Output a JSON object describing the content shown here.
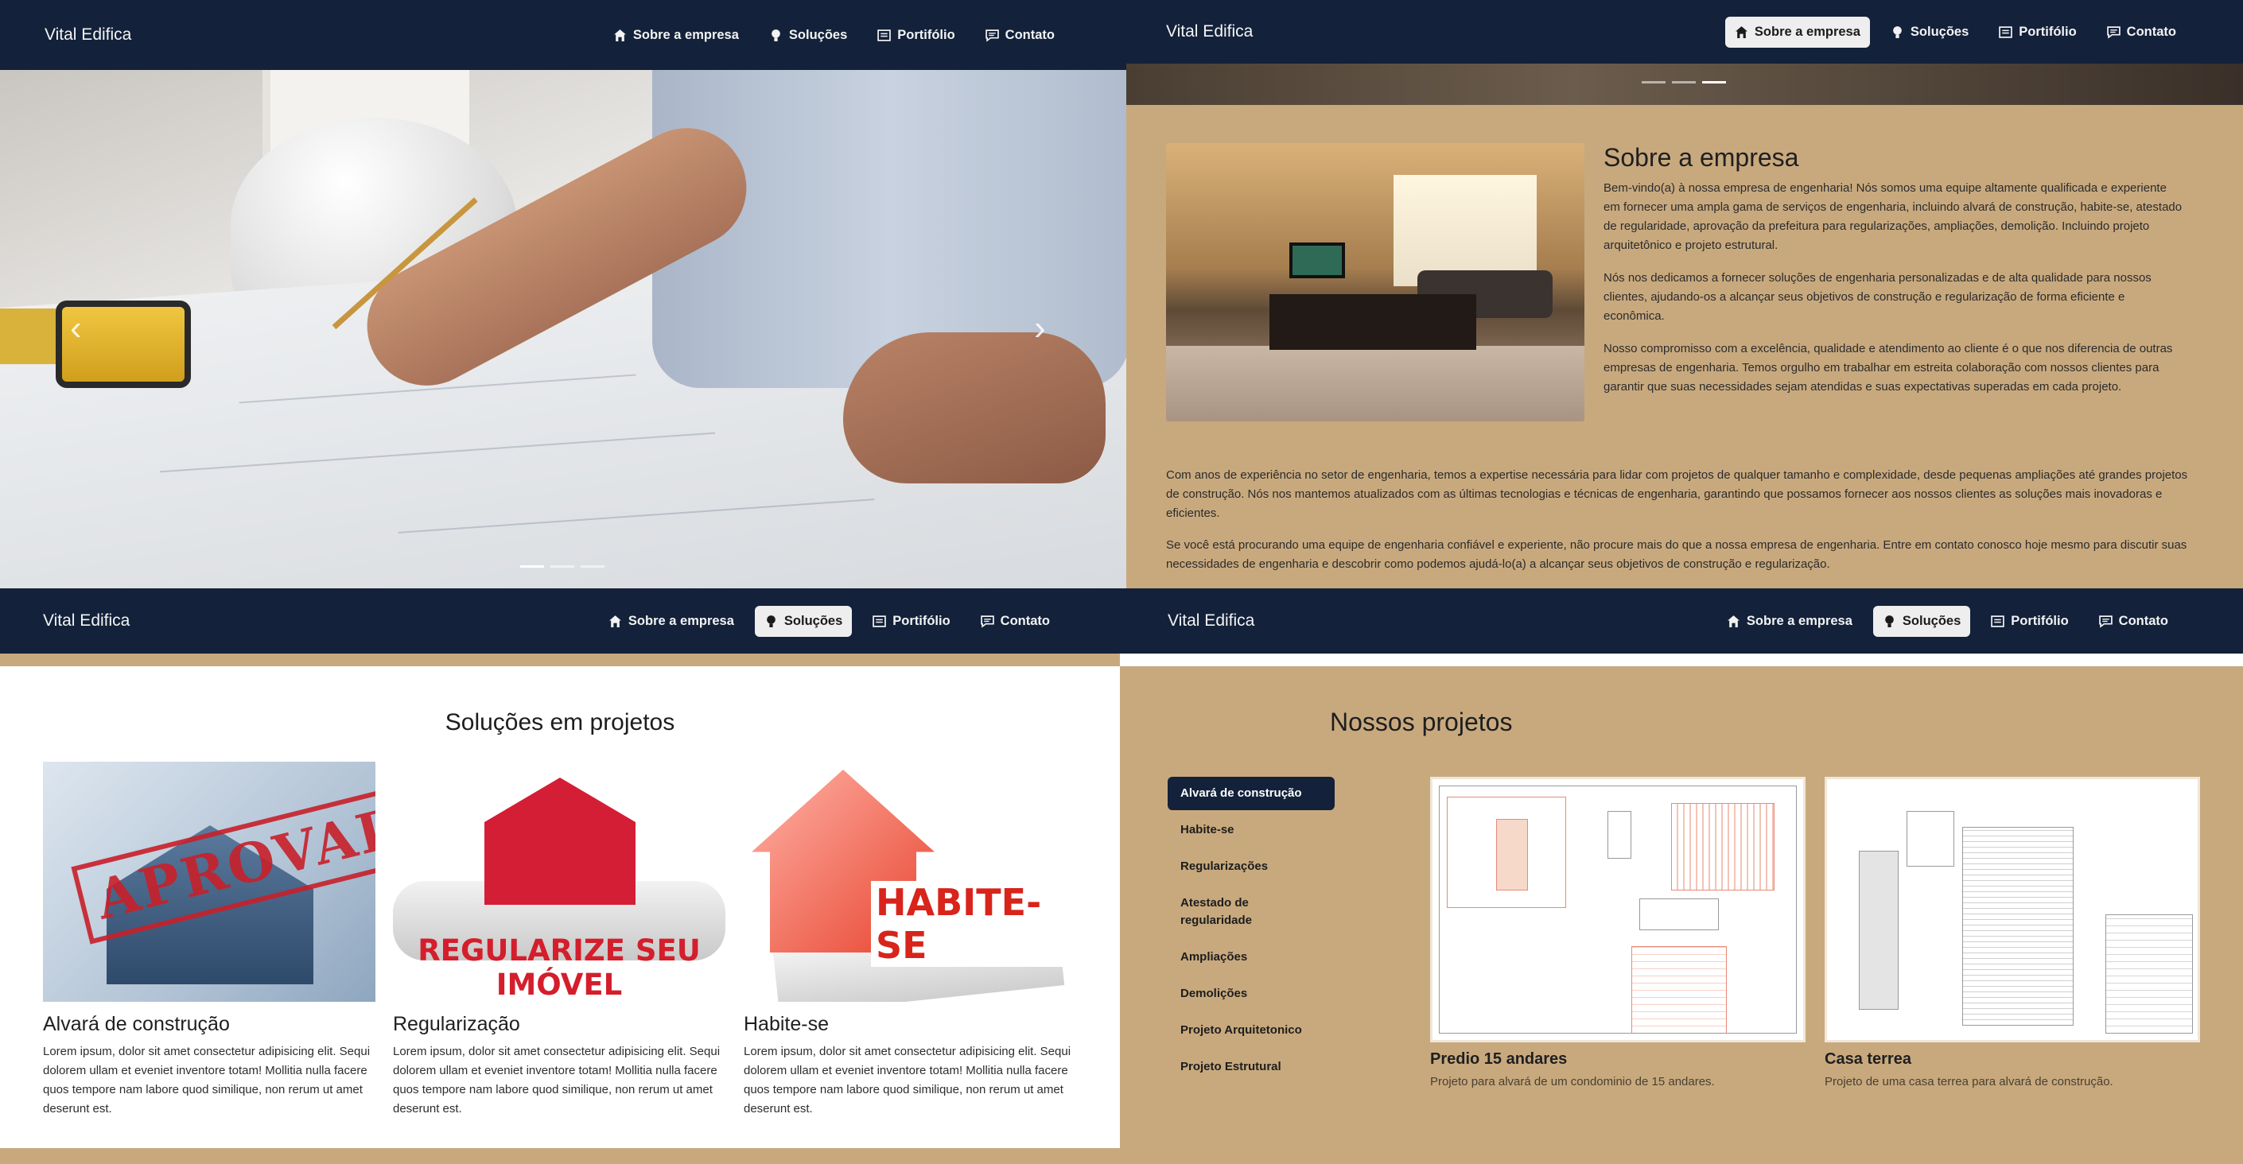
{
  "brand": "Vital Edifica",
  "nav": {
    "about": "Sobre a empresa",
    "solutions": "Soluções",
    "portfolio": "Portifólio",
    "contact": "Contato"
  },
  "carousel": {
    "slides": 3,
    "active_slide": 1
  },
  "about": {
    "title": "Sobre a empresa",
    "p1": "Bem-vindo(a) à nossa empresa de engenharia! Nós somos uma equipe altamente qualificada e experiente em fornecer uma ampla gama de serviços de engenharia, incluindo alvará de construção, habite-se, atestado de regularidade, aprovação da prefeitura para regularizações, ampliações, demolição. Incluindo projeto arquitetônico e projeto estrutural.",
    "p2": "Nós nos dedicamos a fornecer soluções de engenharia personalizadas e de alta qualidade para nossos clientes, ajudando-os a alcançar seus objetivos de construção e regularização de forma eficiente e econômica.",
    "p3": "Nosso compromisso com a excelência, qualidade e atendimento ao cliente é o que nos diferencia de outras empresas de engenharia. Temos orgulho em trabalhar em estreita colaboração com nossos clientes para garantir que suas necessidades sejam atendidas e suas expectativas superadas em cada projeto.",
    "p4": "Com anos de experiência no setor de engenharia, temos a expertise necessária para lidar com projetos de qualquer tamanho e complexidade, desde pequenas ampliações até grandes projetos de construção. Nós nos mantemos atualizados com as últimas tecnologias e técnicas de engenharia, garantindo que possamos fornecer aos nossos clientes as soluções mais inovadoras e eficientes.",
    "p5": "Se você está procurando uma equipe de engenharia confiável e experiente, não procure mais do que a nossa empresa de engenharia. Entre em contato conosco hoje mesmo para discutir suas necessidades de engenharia e descobrir como podemos ajudá-lo(a) a alcançar seus objetivos de construção e regularização."
  },
  "solutions": {
    "title": "Soluções em projetos",
    "cards": [
      {
        "title": "Alvará de construção",
        "stamp": "APROVADO",
        "text": "Lorem ipsum, dolor sit amet consectetur adipisicing elit. Sequi dolorem ullam et eveniet inventore totam! Mollitia nulla facere quos tempore nam labore quod similique, non rerum ut amet deserunt est."
      },
      {
        "title": "Regularização",
        "banner": "REGULARIZE SEU IMÓVEL",
        "text": "Lorem ipsum, dolor sit amet consectetur adipisicing elit. Sequi dolorem ullam et eveniet inventore totam! Mollitia nulla facere quos tempore nam labore quod similique, non rerum ut amet deserunt est."
      },
      {
        "title": "Habite-se",
        "banner": "HABITE-SE",
        "text": "Lorem ipsum, dolor sit amet consectetur adipisicing elit. Sequi dolorem ullam et eveniet inventore totam! Mollitia nulla facere quos tempore nam labore quod similique, non rerum ut amet deserunt est."
      }
    ]
  },
  "projects": {
    "title": "Nossos projetos",
    "categories": [
      "Alvará de construção",
      "Habite-se",
      "Regularizações",
      "Atestado de regularidade",
      "Ampliações",
      "Demolições",
      "Projeto Arquitetonico",
      "Projeto Estrutural"
    ],
    "active_category": "Alvará de construção",
    "items": [
      {
        "name": "Predio 15 andares",
        "desc": "Projeto para alvará de um condominio de 15 andares."
      },
      {
        "name": "Casa terrea",
        "desc": "Projeto de uma casa terrea para alvará de construção."
      }
    ]
  },
  "colors": {
    "navbar": "#13213a",
    "background": "#c8a97e",
    "active_pill": "#13213a"
  }
}
